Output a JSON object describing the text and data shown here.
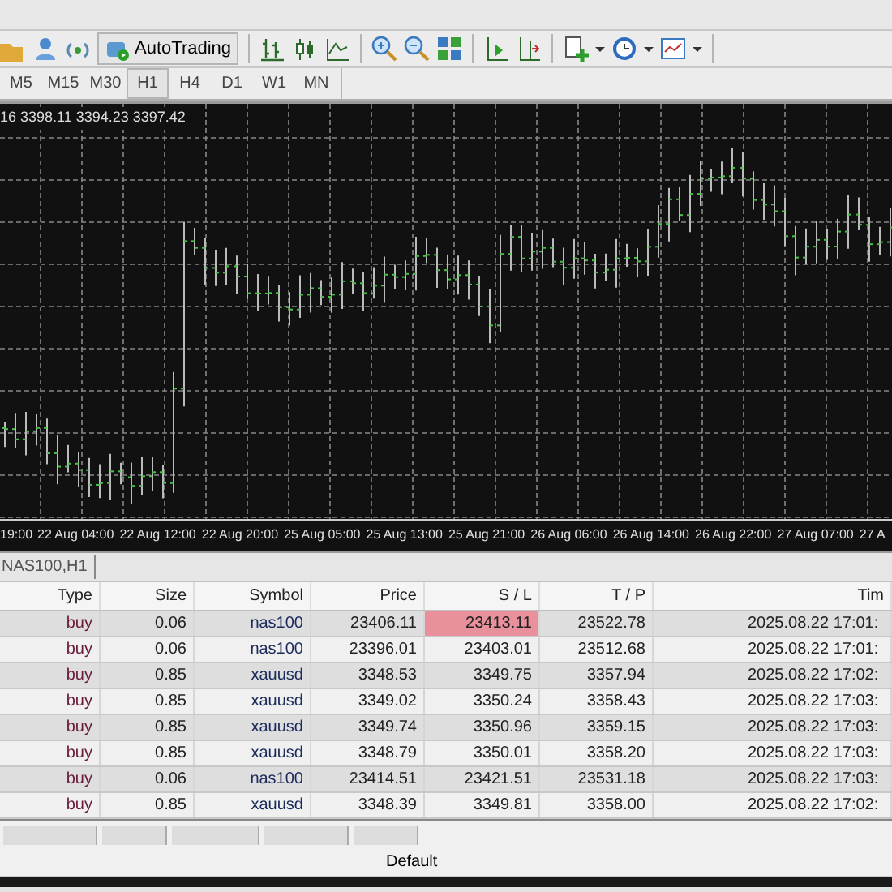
{
  "toolbar": {
    "autotrading": {
      "label": "AutoTrading"
    }
  },
  "timeframes": [
    {
      "label": "M5",
      "selected": false
    },
    {
      "label": "M15",
      "selected": false
    },
    {
      "label": "M30",
      "selected": false
    },
    {
      "label": "H1",
      "selected": true
    },
    {
      "label": "H4",
      "selected": false
    },
    {
      "label": "D1",
      "selected": false
    },
    {
      "label": "W1",
      "selected": false
    },
    {
      "label": "MN",
      "selected": false
    }
  ],
  "chart": {
    "header": "16 3398.11 3394.23 3397.42",
    "time_labels": [
      "19:00",
      "22 Aug 04:00",
      "22 Aug 12:00",
      "22 Aug 20:00",
      "25 Aug 05:00",
      "25 Aug 13:00",
      "25 Aug 21:00",
      "26 Aug 06:00",
      "26 Aug 14:00",
      "26 Aug 22:00",
      "27 Aug 07:00",
      "27 A"
    ]
  },
  "chart_tab": {
    "label": "NAS100,H1"
  },
  "table": {
    "columns": [
      "Type",
      "Size",
      "Symbol",
      "Price",
      "S / L",
      "T / P",
      "Tim"
    ],
    "rows": [
      {
        "cells": [
          "buy",
          "0.06",
          "nas100",
          "23406.11",
          "23413.11",
          "23522.78",
          "2025.08.22 17:01:"
        ],
        "sl_highlight": true
      },
      {
        "cells": [
          "buy",
          "0.06",
          "nas100",
          "23396.01",
          "23403.01",
          "23512.68",
          "2025.08.22 17:01:"
        ],
        "sl_highlight": false
      },
      {
        "cells": [
          "buy",
          "0.85",
          "xauusd",
          "3348.53",
          "3349.75",
          "3357.94",
          "2025.08.22 17:02:"
        ],
        "sl_highlight": false
      },
      {
        "cells": [
          "buy",
          "0.85",
          "xauusd",
          "3349.02",
          "3350.24",
          "3358.43",
          "2025.08.22 17:03:"
        ],
        "sl_highlight": false
      },
      {
        "cells": [
          "buy",
          "0.85",
          "xauusd",
          "3349.74",
          "3350.96",
          "3359.15",
          "2025.08.22 17:03:"
        ],
        "sl_highlight": false
      },
      {
        "cells": [
          "buy",
          "0.85",
          "xauusd",
          "3348.79",
          "3350.01",
          "3358.20",
          "2025.08.22 17:03:"
        ],
        "sl_highlight": false
      },
      {
        "cells": [
          "buy",
          "0.06",
          "nas100",
          "23414.51",
          "23421.51",
          "23531.18",
          "2025.08.22 17:03:"
        ],
        "sl_highlight": false
      },
      {
        "cells": [
          "buy",
          "0.85",
          "xauusd",
          "3348.39",
          "3349.81",
          "3358.00",
          "2025.08.22 17:02:"
        ],
        "sl_highlight": false
      }
    ]
  },
  "footer": {
    "label": "Default"
  }
}
